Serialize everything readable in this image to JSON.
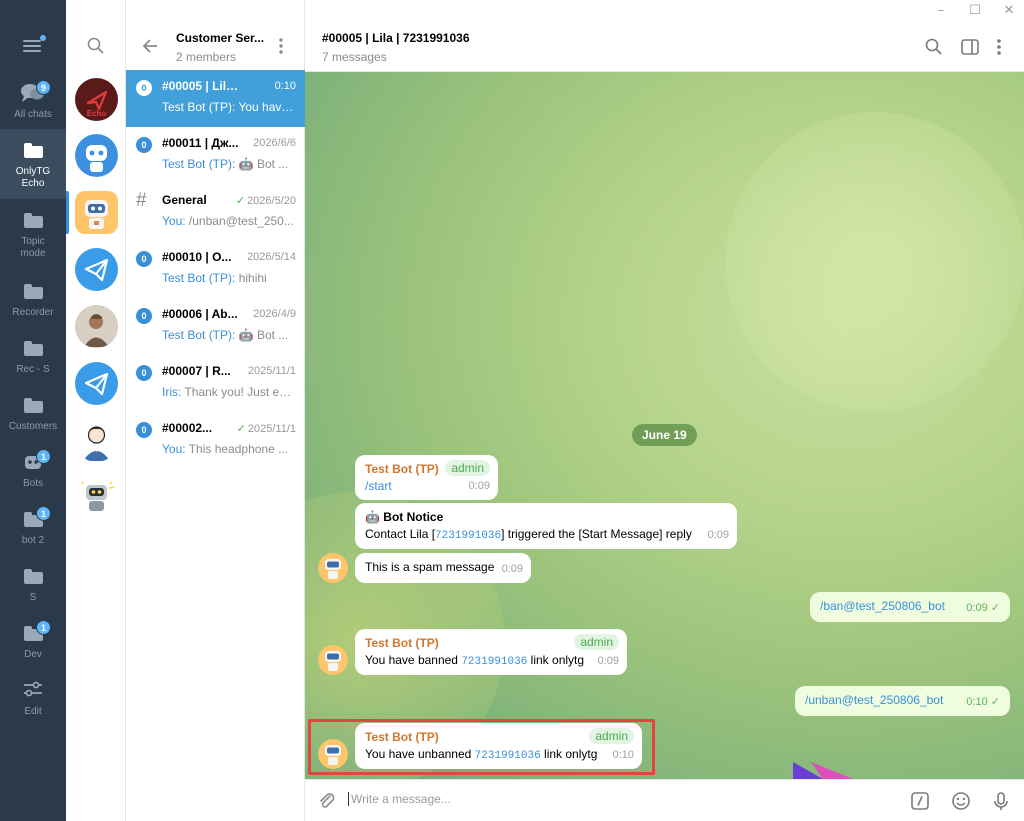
{
  "window_controls": {
    "minimize": "–",
    "maximize": "☐",
    "close": "✕"
  },
  "folders": [
    {
      "label": "All chats",
      "badge": "9",
      "icon": "chats-icon",
      "active": false
    },
    {
      "label": "OnlyTG Echo",
      "badge": "",
      "icon": "folder-icon",
      "active": true
    },
    {
      "label": "Topic mode",
      "badge": "",
      "icon": "folder-icon",
      "active": false
    },
    {
      "label": "Recorder",
      "badge": "",
      "icon": "folder-icon",
      "active": false
    },
    {
      "label": "Rec - S",
      "badge": "",
      "icon": "folder-icon",
      "active": false
    },
    {
      "label": "Customers",
      "badge": "",
      "icon": "folder-icon",
      "active": false
    },
    {
      "label": "Bots",
      "badge": "1",
      "icon": "bots-icon",
      "active": false
    },
    {
      "label": "bot 2",
      "badge": "1",
      "icon": "folder-icon",
      "active": false
    },
    {
      "label": "S",
      "badge": "",
      "icon": "folder-icon",
      "active": false
    },
    {
      "label": "Dev",
      "badge": "1",
      "icon": "folder-icon",
      "active": false
    },
    {
      "label": "Edit",
      "badge": "",
      "icon": "sliders-icon",
      "active": false
    }
  ],
  "avatar_column": {
    "echo_label": "Echo"
  },
  "chatlist": {
    "title": "Customer Ser...",
    "subtitle": "2 members",
    "items": [
      {
        "title": "#00005 | Lila | 7...",
        "time": "0:10",
        "who": "Test Bot (TP): ",
        "preview": "You have...",
        "badge": "0",
        "active": true,
        "checked": false
      },
      {
        "title": "#00011 | Дж...",
        "time": "2026/6/6",
        "who": "Test Bot (TP): ",
        "preview": "🤖 Bot ...",
        "badge": "0",
        "active": false,
        "checked": false
      },
      {
        "title": "General",
        "time": "2026/5/20",
        "who": "You: ",
        "preview": "/unban@test_250...",
        "badge": "#",
        "active": false,
        "checked": true
      },
      {
        "title": "#00010 | O...",
        "time": "2026/5/14",
        "who": "Test Bot (TP): ",
        "preview": "hihihi",
        "badge": "0",
        "active": false,
        "checked": false
      },
      {
        "title": "#00006 | Ab...",
        "time": "2026/4/9",
        "who": "Test Bot (TP): ",
        "preview": "🤖 Bot ...",
        "badge": "0",
        "active": false,
        "checked": false
      },
      {
        "title": "#00007 | R...",
        "time": "2025/11/1",
        "who": "Iris: ",
        "preview": "Thank you! Just enj...",
        "badge": "0",
        "active": false,
        "checked": false
      },
      {
        "title": "#00002...",
        "time": "2025/11/1",
        "who": "You: ",
        "preview": "This headphone ...",
        "badge": "0",
        "active": false,
        "checked": true
      }
    ]
  },
  "chat": {
    "title": "#00005 | Lila | 7231991036",
    "subtitle": "7 messages",
    "date_pill": "June 19",
    "messages": {
      "m1": {
        "sender": "Test Bot (TP)",
        "role": "admin",
        "text": "/start",
        "time": "0:09"
      },
      "m2": {
        "title": "🤖 Bot Notice",
        "text_a": "Contact Lila [",
        "id": "7231991036",
        "text_b": "]  triggered the [Start Message] reply",
        "time": "0:09"
      },
      "m3": {
        "text": "This is a spam message",
        "time": "0:09"
      },
      "m4": {
        "text": "/ban@test_250806_bot",
        "time": "0:09",
        "check": "✓"
      },
      "m5": {
        "sender": "Test Bot (TP)",
        "role": "admin",
        "text_a": "You have banned ",
        "id": "7231991036",
        "text_b": " link onlytg",
        "time": "0:09"
      },
      "m6": {
        "text": "/unban@test_250806_bot",
        "time": "0:10",
        "check": "✓"
      },
      "m7": {
        "sender": "Test Bot (TP)",
        "role": "admin",
        "text_a": "You have unbanned ",
        "id": "7231991036",
        "text_b": " link onlytg",
        "time": "0:10"
      }
    },
    "composer_placeholder": "Write a message..."
  },
  "colors": {
    "accent": "#419fd9",
    "rail": "#2b3a4a",
    "highlight": "#e0483f",
    "admin": "#4eaa4e",
    "sender": "#d0772e"
  }
}
